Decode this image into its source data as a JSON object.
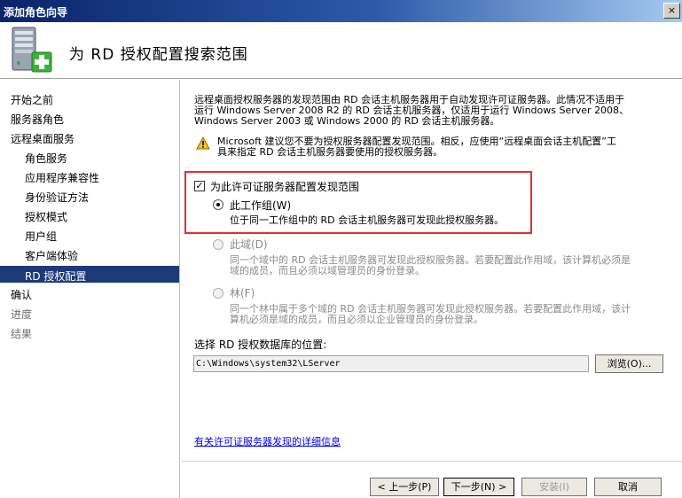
{
  "window": {
    "title": "添加角色向导",
    "close_glyph": "×"
  },
  "header": {
    "title": "为 RD 授权配置搜索范围",
    "icon": "server-add-icon"
  },
  "sidebar": {
    "items": [
      {
        "label": "开始之前"
      },
      {
        "label": "服务器角色"
      },
      {
        "label": "远程桌面服务"
      },
      {
        "label": "角色服务"
      },
      {
        "label": "应用程序兼容性"
      },
      {
        "label": "身份验证方法"
      },
      {
        "label": "授权模式"
      },
      {
        "label": "用户组"
      },
      {
        "label": "客户端体验"
      },
      {
        "label": "RD 授权配置"
      },
      {
        "label": "确认"
      },
      {
        "label": "进度"
      },
      {
        "label": "结果"
      }
    ]
  },
  "content": {
    "intro_line1": "远程桌面授权服务器的发现范围由 RD 会话主机服务器用于自动发现许可证服务器。此情况不适用于",
    "intro_line2": "运行 Windows Server 2008 R2 的 RD 会话主机服务器，仅适用于运行 Windows Server 2008、",
    "intro_line3": "Windows Server 2003 或 Windows 2000 的 RD 会话主机服务器。",
    "warning_line1": "Microsoft 建议您不要为授权服务器配置发现范围。相反，应使用“远程桌面会话主机配置”工",
    "warning_line2": "具来指定 RD 会话主机服务器要使用的授权服务器。",
    "configure_checkbox": {
      "label": "为此许可证服务器配置发现范围",
      "glyph": "✓"
    },
    "workgroup": {
      "label": "此工作组(W)",
      "desc": "位于同一工作组中的 RD 会话主机服务器可发现此授权服务器。"
    },
    "domain": {
      "label": "此域(D)",
      "desc1": "同一个域中的 RD 会话主机服务器可发现此授权服务器。若要配置此作用域，该计算机必须是",
      "desc2": "域的成员，而且必须以域管理员的身份登录。"
    },
    "forest": {
      "label": "林(F)",
      "desc1": "同一个林中属于多个域的 RD 会话主机服务器可发现此授权服务器。若要配置此作用域，该计",
      "desc2": "算机必须是域的成员，而且必须以企业管理员的身份登录。"
    },
    "db_label": "选择 RD 授权数据库的位置:",
    "db_path": "C:\\Windows\\system32\\LServer",
    "browse_label": "浏览(O)...",
    "more_info_link": "有关许可证服务器发现的详细信息"
  },
  "footer": {
    "back_label": "< 上一步(P)",
    "next_label": "下一步(N) >",
    "install_label": "安装(I)",
    "cancel_label": "取消"
  },
  "colors": {
    "selected_nav": "#1c3a78",
    "highlight_box": "#e03030",
    "link": "#0000ee"
  }
}
